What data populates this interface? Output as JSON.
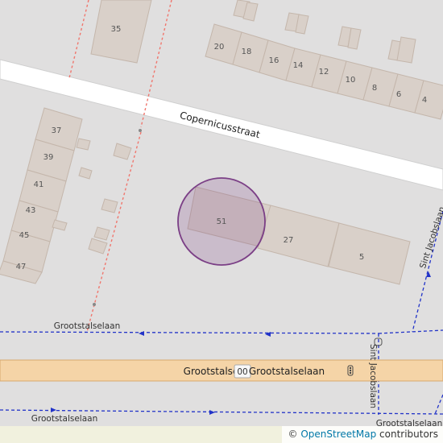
{
  "map": {
    "streets": {
      "copernicusstraat": "Copernicusstraat",
      "grootstalselaan_main": "Grootstalselaan",
      "grootstalselaan_left": "Grootstalse",
      "grootstalselaan_ref": "00",
      "grootstalselaan_path_upper": "Grootstalselaan",
      "grootstalselaan_path_lower": "Grootstalselaan",
      "grootstalselaan_path_lower_right": "Grootstalselaan",
      "sint_jacobslaan_upper": "Sint Jacobslaan",
      "sint_jacobslaan_lower": "Sint Jacobslaan"
    },
    "house_numbers": {
      "n35": "35",
      "n20": "20",
      "n18": "18",
      "n16": "16",
      "n14": "14",
      "n12": "12",
      "n10": "10",
      "n8": "8",
      "n6": "6",
      "n4": "4",
      "n37": "37",
      "n39": "39",
      "n41": "41",
      "n43": "43",
      "n45": "45",
      "n47": "47",
      "n51": "51",
      "n27": "27",
      "n5": "5"
    },
    "highlight_color": "#7b3f86",
    "attribution_prefix": "© ",
    "attribution_link": "OpenStreetMap",
    "attribution_suffix": " contributors"
  }
}
